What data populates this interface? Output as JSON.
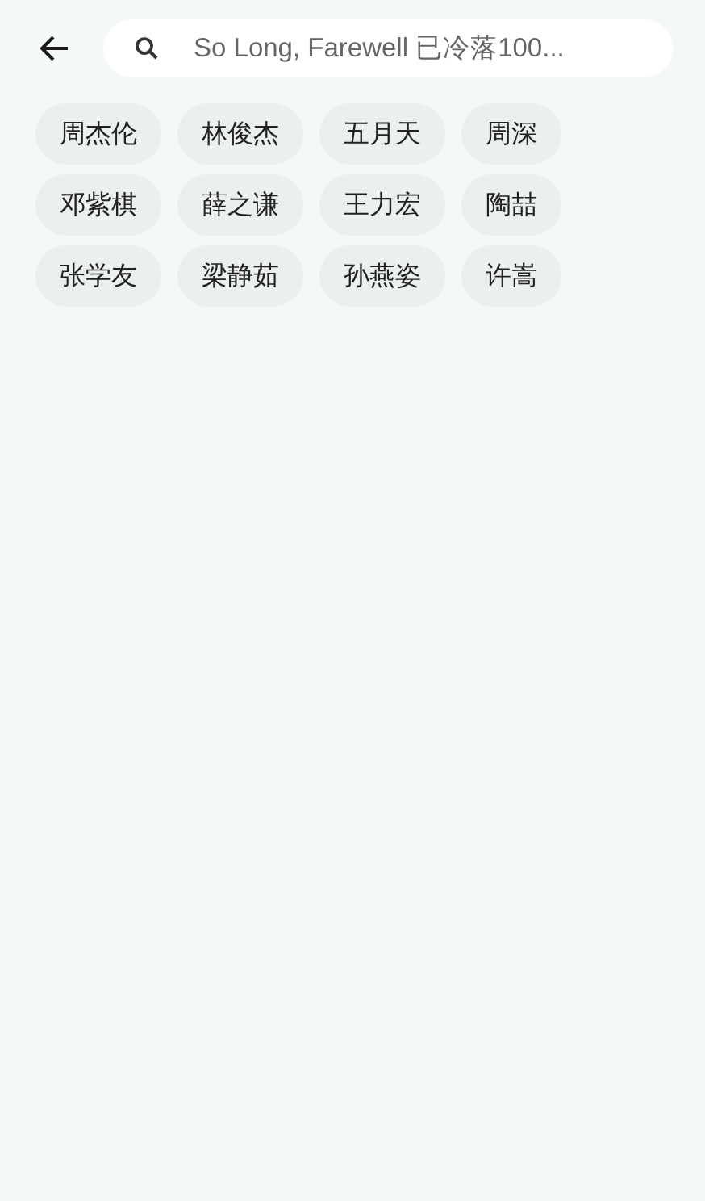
{
  "search": {
    "placeholder": "So Long, Farewell 已冷落100..."
  },
  "tags": [
    {
      "label": "周杰伦"
    },
    {
      "label": "林俊杰"
    },
    {
      "label": "五月天"
    },
    {
      "label": "周深"
    },
    {
      "label": "邓紫棋"
    },
    {
      "label": "薛之谦"
    },
    {
      "label": "王力宏"
    },
    {
      "label": "陶喆"
    },
    {
      "label": "张学友"
    },
    {
      "label": "梁静茹"
    },
    {
      "label": "孙燕姿"
    },
    {
      "label": "许嵩"
    }
  ]
}
